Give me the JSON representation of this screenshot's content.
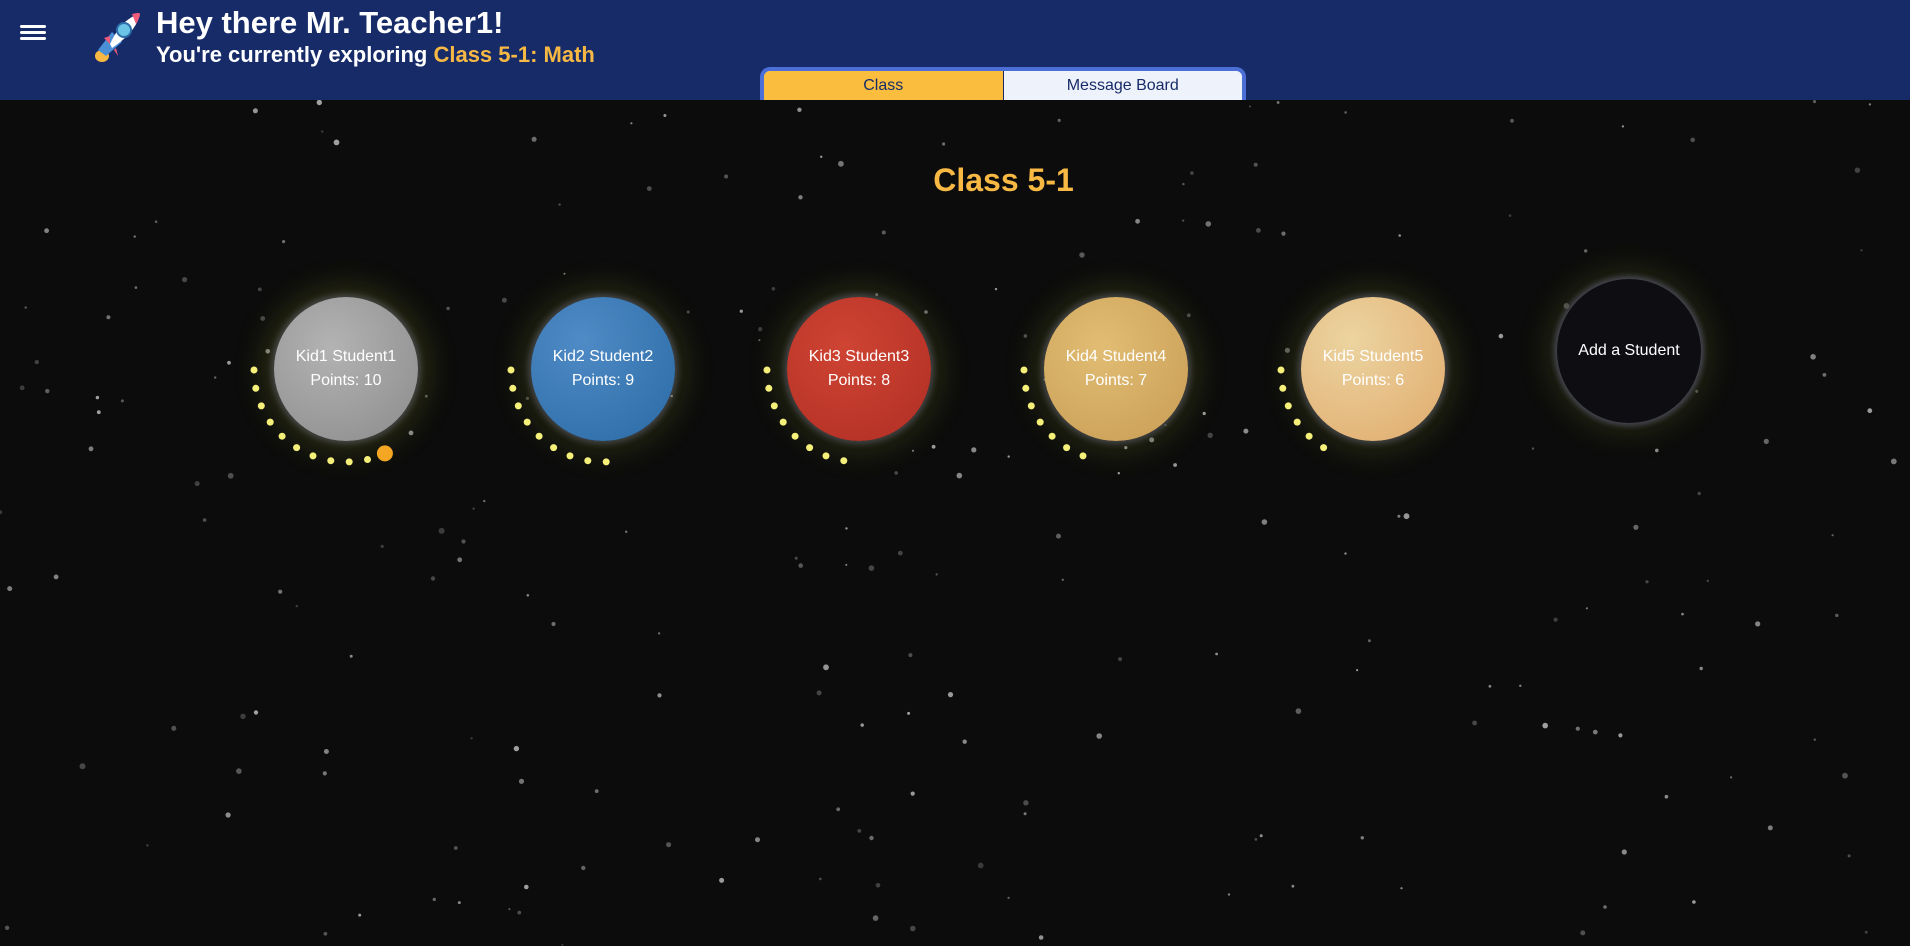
{
  "header": {
    "greeting": "Hey there Mr. Teacher1!",
    "subtitle_prefix": "You're currently exploring ",
    "subtitle_class": "Class 5-1: Math",
    "menu_icon": "hamburger-menu-icon",
    "logo_icon": "rocket-icon"
  },
  "tabs": [
    {
      "label": "Class",
      "active": true
    },
    {
      "label": "Message Board",
      "active": false
    }
  ],
  "class_title": "Class 5-1",
  "students": [
    {
      "name": "Kid1 Student1",
      "points_label": "Points: 10",
      "points": 10,
      "color": "#9e9e9e"
    },
    {
      "name": "Kid2 Student2",
      "points_label": "Points: 9",
      "points": 9,
      "color": "#3a78b4"
    },
    {
      "name": "Kid3 Student3",
      "points_label": "Points: 8",
      "points": 8,
      "color": "#c0392b"
    },
    {
      "name": "Kid4 Student4",
      "points_label": "Points: 7",
      "points": 7,
      "color": "#d4ac66"
    },
    {
      "name": "Kid5 Student5",
      "points_label": "Points: 6",
      "points": 6,
      "color": "#e5bf86"
    }
  ],
  "add_student_label": "Add a Student",
  "colors": {
    "header_bg": "#172b69",
    "accent": "#f7b944",
    "background": "#0c0c0c",
    "orbit_dot": "#f5f07a",
    "orbit_marker": "#f5a623"
  }
}
